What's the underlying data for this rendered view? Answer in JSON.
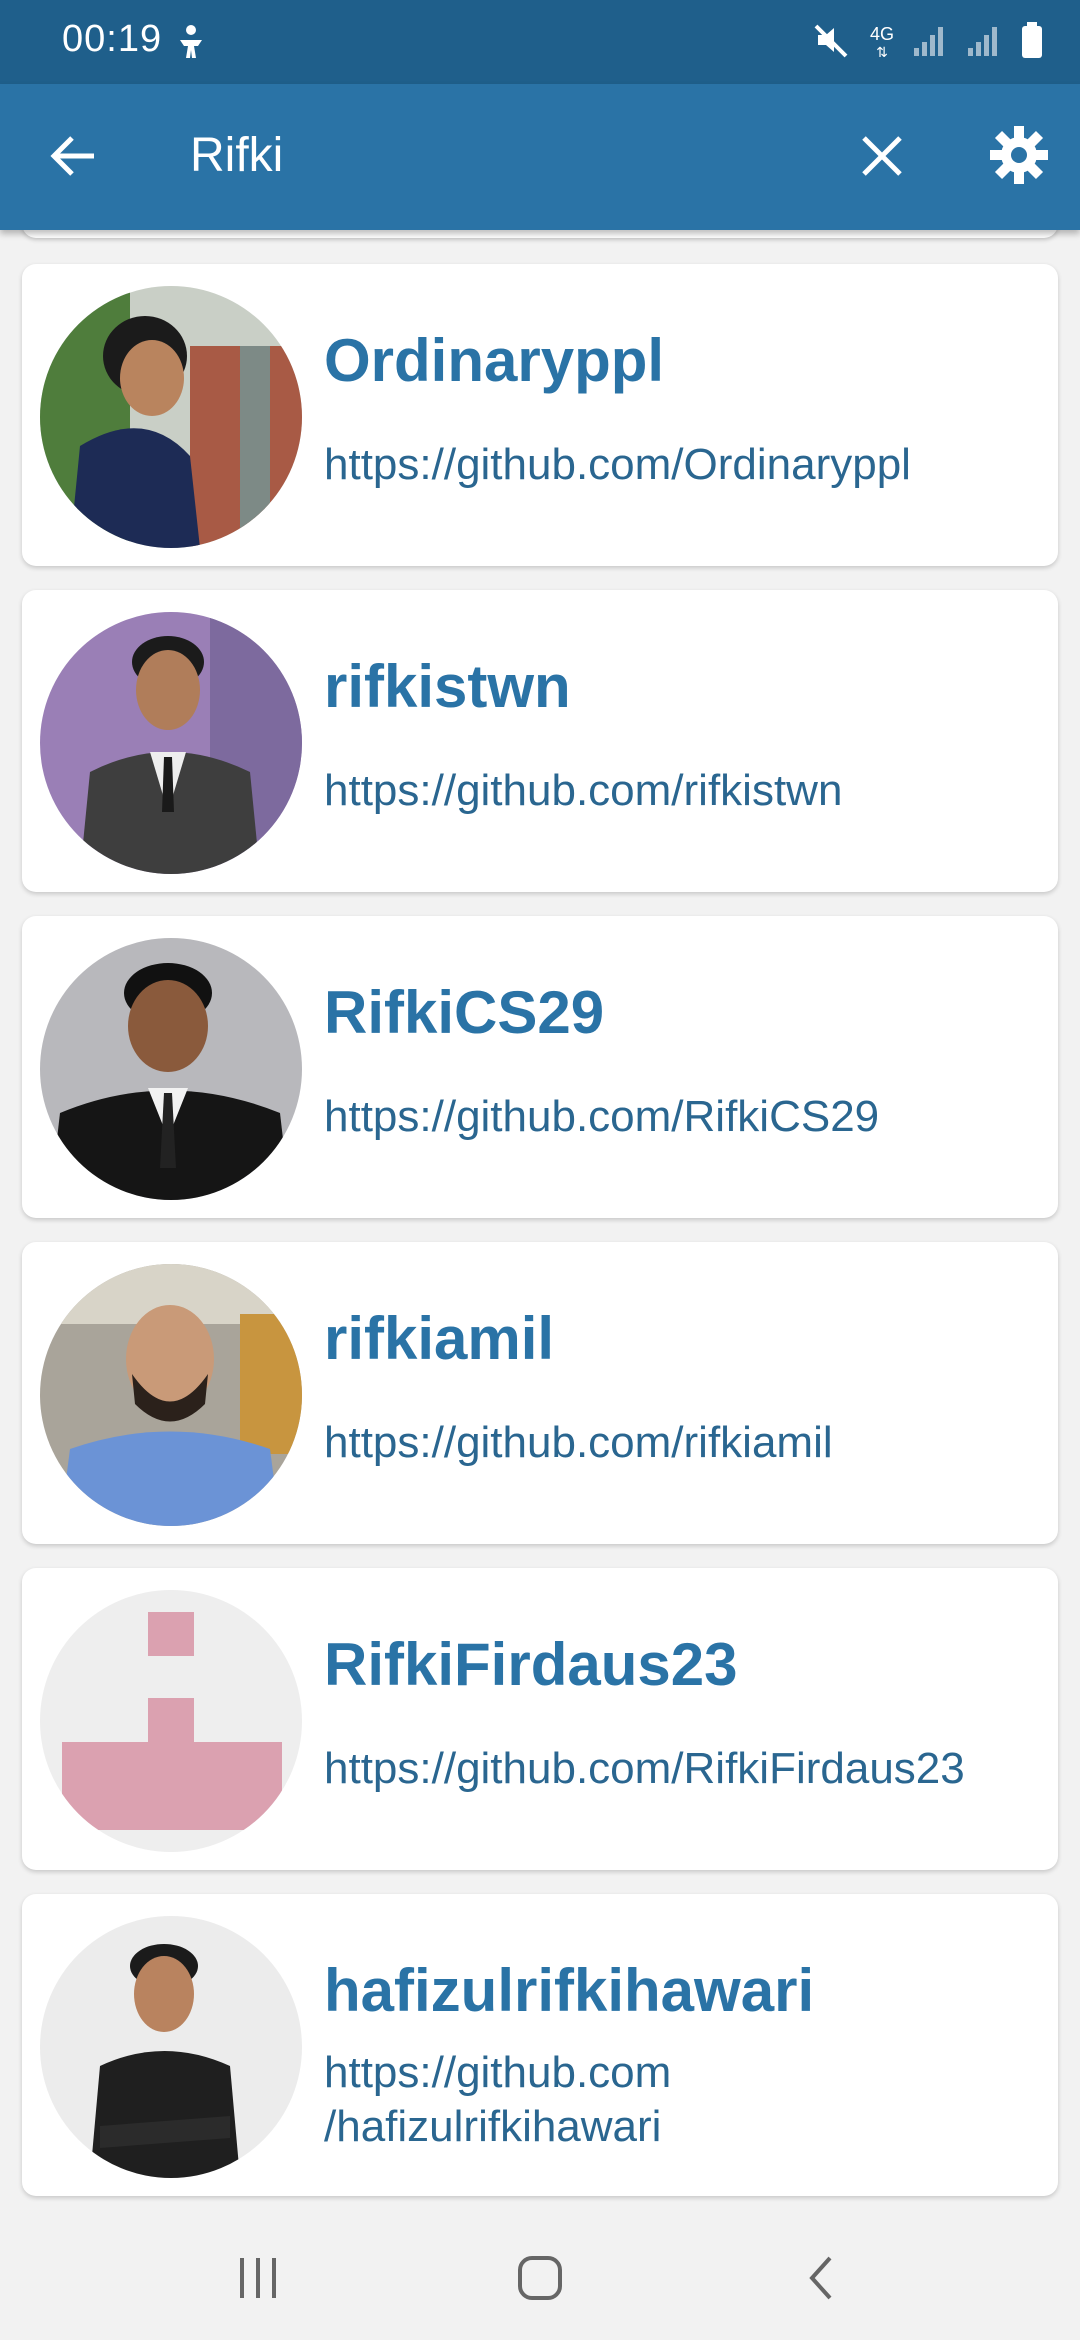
{
  "status_bar": {
    "time": "00:19",
    "network": "4G"
  },
  "app_bar": {
    "search_query": "Rifki",
    "icons": {
      "back": "arrow-back-icon",
      "clear": "close-icon",
      "settings": "gear-icon"
    }
  },
  "results": [
    {
      "username": "Ordinaryppl",
      "url": "https://github.com/Ordinaryppl"
    },
    {
      "username": "rifkistwn",
      "url": "https://github.com/rifkistwn"
    },
    {
      "username": "RifkiCS29",
      "url": "https://github.com/RifkiCS29"
    },
    {
      "username": "rifkiamil",
      "url": "https://github.com/rifkiamil"
    },
    {
      "username": "RifkiFirdaus23",
      "url": "https://github.com/RifkiFirdaus23"
    },
    {
      "username": "hafizulrifkihawari",
      "url_line1": "https://github.com",
      "url_line2": "/hafizulrifkihawari"
    }
  ],
  "colors": {
    "status_bar": "#1f5f8b",
    "app_bar": "#2a73a6",
    "username": "#2a73a6",
    "url": "#2a6690",
    "background": "#f2f2f2",
    "card": "#ffffff"
  }
}
